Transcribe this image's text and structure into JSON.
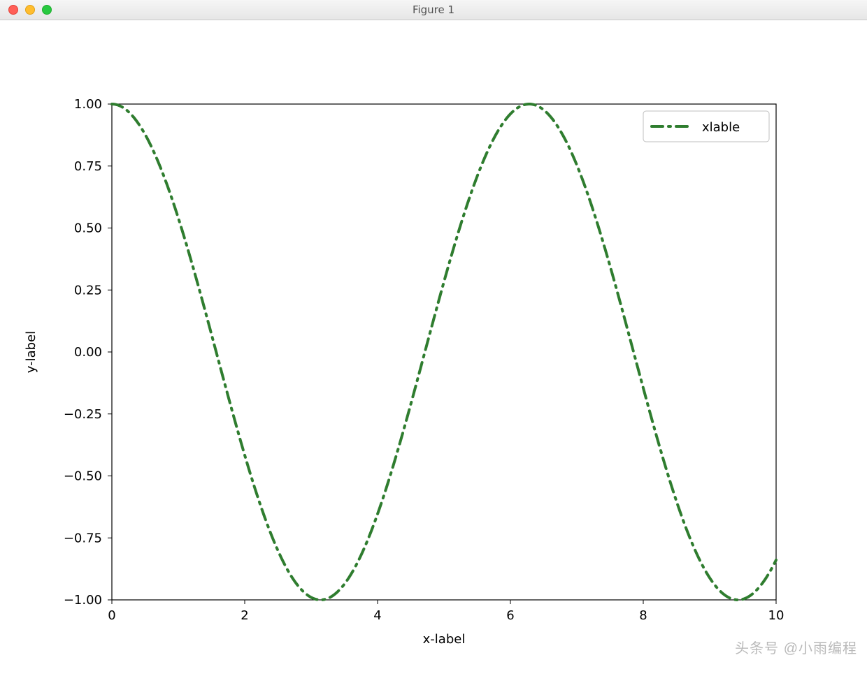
{
  "window": {
    "title": "Figure 1"
  },
  "watermark": "头条号 @小雨编程",
  "chart_data": {
    "type": "line",
    "title": "",
    "xlabel": "x-label",
    "ylabel": "y-label",
    "xlim": [
      0,
      10
    ],
    "ylim": [
      -1.0,
      1.0
    ],
    "xticks": [
      0,
      2,
      4,
      6,
      8,
      10
    ],
    "yticks": [
      -1.0,
      -0.75,
      -0.5,
      -0.25,
      0.0,
      0.25,
      0.5,
      0.75,
      1.0
    ],
    "legend": {
      "position": "upper right",
      "entries": [
        "xlable"
      ]
    },
    "line_style": "dash-dot",
    "line_color": "#2f7d2f",
    "series": [
      {
        "name": "xlable",
        "function": "cos(x)",
        "x_range": [
          0,
          10
        ],
        "x": [
          0.0,
          0.2,
          0.4,
          0.6,
          0.8,
          1.0,
          1.2,
          1.4,
          1.6,
          1.8,
          2.0,
          2.2,
          2.4,
          2.6,
          2.8,
          3.0,
          3.2,
          3.4,
          3.6,
          3.8,
          4.0,
          4.2,
          4.4,
          4.6,
          4.8,
          5.0,
          5.2,
          5.4,
          5.6,
          5.8,
          6.0,
          6.2,
          6.4,
          6.6,
          6.8,
          7.0,
          7.2,
          7.4,
          7.6,
          7.8,
          8.0,
          8.2,
          8.4,
          8.6,
          8.8,
          9.0,
          9.2,
          9.4,
          9.6,
          9.8,
          10.0
        ],
        "y": [
          1.0,
          0.98,
          0.921,
          0.825,
          0.697,
          0.54,
          0.362,
          0.17,
          -0.029,
          -0.227,
          -0.416,
          -0.589,
          -0.737,
          -0.857,
          -0.942,
          -0.99,
          -0.998,
          -0.967,
          -0.897,
          -0.791,
          -0.654,
          -0.49,
          -0.307,
          -0.112,
          0.087,
          0.284,
          0.469,
          0.635,
          0.776,
          0.886,
          0.96,
          0.996,
          0.993,
          0.95,
          0.869,
          0.754,
          0.608,
          0.439,
          0.252,
          0.054,
          -0.146,
          -0.339,
          -0.519,
          -0.678,
          -0.811,
          -0.911,
          -0.975,
          -0.999,
          -0.984,
          -0.93,
          -0.839
        ]
      }
    ]
  }
}
